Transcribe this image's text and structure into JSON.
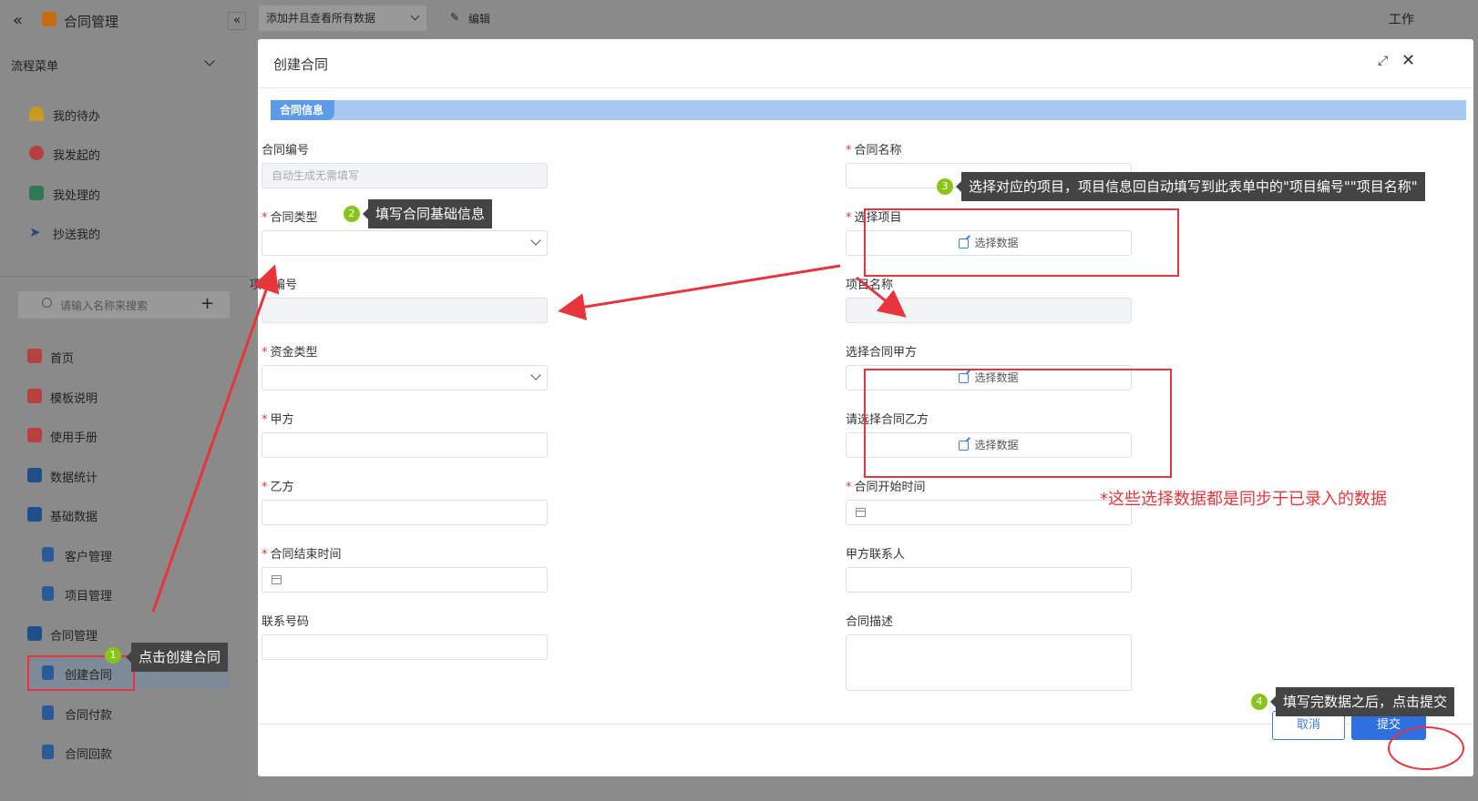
{
  "app": {
    "title": "合同管理",
    "menu_header": "流程菜单",
    "top_dropdown": "添加并且查看所有数据",
    "top_edit": "编辑",
    "top_right": "工作",
    "search_placeholder": "请输入名称来搜索",
    "flow_items": [
      "我的待办",
      "我发起的",
      "我处理的",
      "抄送我的"
    ],
    "nav_items": [
      "首页",
      "模板说明",
      "使用手册",
      "数据统计",
      "基础数据",
      "客户管理",
      "项目管理",
      "合同管理",
      "创建合同",
      "合同付款",
      "合同回款"
    ]
  },
  "dialog": {
    "title": "创建合同",
    "section": "合同信息",
    "fields": {
      "contract_no": "合同编号",
      "contract_no_placeholder": "自动生成无需填写",
      "contract_name": "合同名称",
      "contract_type": "合同类型",
      "select_project": "选择项目",
      "project_no": "项目编号",
      "project_name": "项目名称",
      "fund_type": "资金类型",
      "select_party_a": "选择合同甲方",
      "party_a": "甲方",
      "select_party_b": "请选择合同乙方",
      "party_b": "乙方",
      "start_time": "合同开始时间",
      "end_time": "合同结束时间",
      "party_a_contact": "甲方联系人",
      "phone": "联系号码",
      "description": "合同描述"
    },
    "select_data": "选择数据",
    "cancel": "取消",
    "submit": "提交"
  },
  "annotations": {
    "step1": "1",
    "step1_text": "点击创建合同",
    "step2": "2",
    "step2_text": "填写合同基础信息",
    "step3": "3",
    "step3_text": "选择对应的项目，项目信息回自动填写到此表单中的\"项目编号\"\"项目名称\"",
    "step4": "4",
    "step4_text": "填写完数据之后，点击提交",
    "note": "*这些选择数据都是同步于已录入的数据"
  },
  "colors": {
    "accent": "#2f6fe0",
    "annotation_red": "#e8343b",
    "step_green": "#8ac41a",
    "section_bar": "#a9c9f2"
  }
}
